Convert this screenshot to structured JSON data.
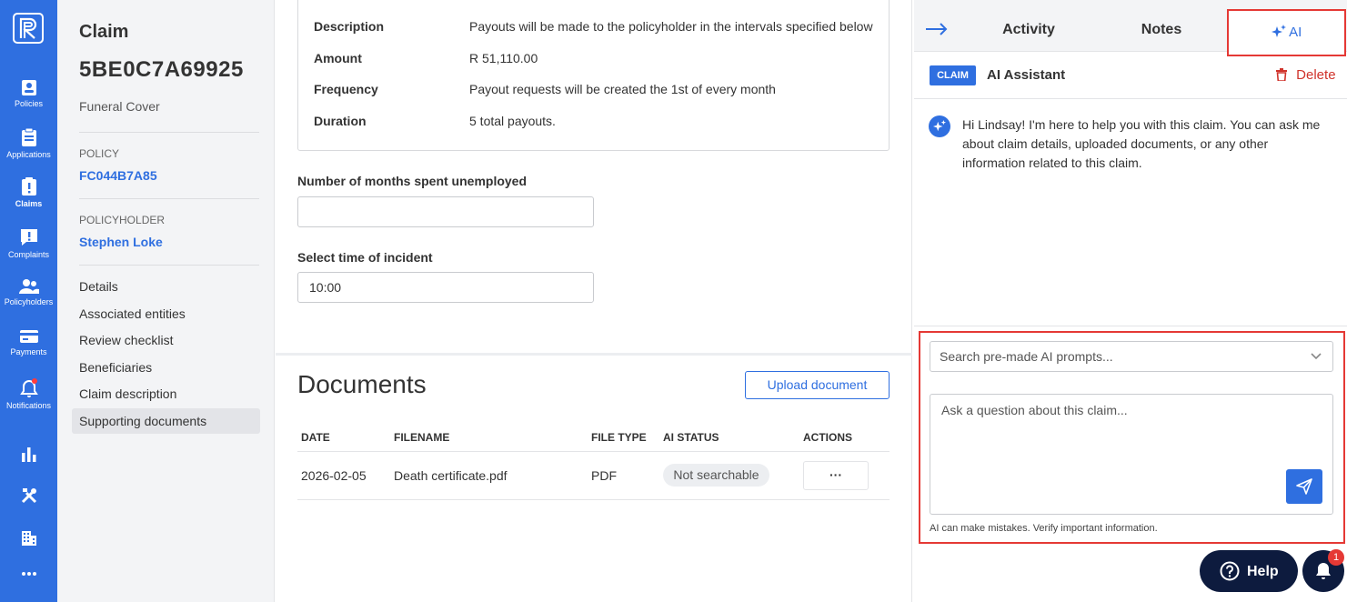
{
  "rail": {
    "items": [
      {
        "label": "Policies",
        "icon": "policies-icon"
      },
      {
        "label": "Applications",
        "icon": "applications-icon"
      },
      {
        "label": "Claims",
        "icon": "claims-icon"
      },
      {
        "label": "Complaints",
        "icon": "complaints-icon"
      },
      {
        "label": "Policyholders",
        "icon": "policyholders-icon"
      },
      {
        "label": "Payments",
        "icon": "payments-icon"
      },
      {
        "label": "Notifications",
        "icon": "notifications-icon"
      }
    ]
  },
  "sidebar": {
    "heading": "Claim",
    "claim_id": "5BE0C7A69925",
    "product": "Funeral Cover",
    "policy_caption": "POLICY",
    "policy_number": "FC044B7A85",
    "policyholder_caption": "POLICYHOLDER",
    "policyholder_name": "Stephen Loke",
    "nav": [
      {
        "label": "Details"
      },
      {
        "label": "Associated entities"
      },
      {
        "label": "Review checklist"
      },
      {
        "label": "Beneficiaries"
      },
      {
        "label": "Claim description"
      },
      {
        "label": "Supporting documents"
      }
    ]
  },
  "payout": {
    "rows": [
      {
        "label": "Description",
        "value": "Payouts will be made to the policyholder in the intervals specified below"
      },
      {
        "label": "Amount",
        "value": "R 51,110.00"
      },
      {
        "label": "Frequency",
        "value": "Payout requests will be created the 1st of every month"
      },
      {
        "label": "Duration",
        "value": "5 total payouts."
      }
    ]
  },
  "form": {
    "months_label": "Number of months spent unemployed",
    "months_value": "",
    "time_label": "Select time of incident",
    "time_value": "10:00"
  },
  "documents": {
    "title": "Documents",
    "upload_label": "Upload document",
    "headers": [
      "DATE",
      "FILENAME",
      "FILE TYPE",
      "AI STATUS",
      "ACTIONS"
    ],
    "rows": [
      {
        "date": "2026-02-05",
        "filename": "Death certificate.pdf",
        "file_type": "PDF",
        "ai_status": "Not searchable",
        "actions": "···"
      }
    ]
  },
  "right_panel": {
    "tabs": [
      "Activity",
      "Notes"
    ],
    "ai_tab_label": "AI",
    "claim_tag": "CLAIM",
    "assistant_title": "AI Assistant",
    "delete_label": "Delete",
    "bot_message": "Hi Lindsay! I'm here to help you with this claim. You can ask me about claim details, uploaded documents, or any other information related to this claim.",
    "prompt_placeholder": "Search pre-made AI prompts...",
    "question_placeholder": "Ask a question about this claim...",
    "disclaimer": "AI can make mistakes. Verify important information.",
    "help_label": "Help",
    "notification_count": "1"
  },
  "colors": {
    "brand_blue": "#2f6fe0",
    "highlight_red": "#e53935",
    "delete_red": "#d0342c",
    "help_navy": "#0d1b3e"
  }
}
